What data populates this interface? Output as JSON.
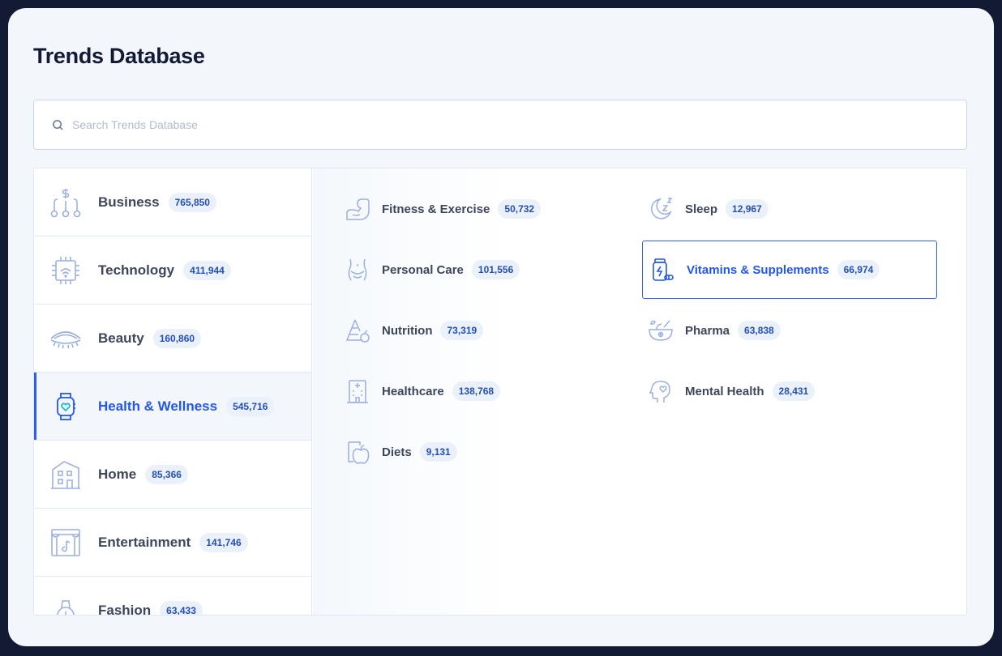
{
  "page": {
    "title": "Trends Database"
  },
  "search": {
    "placeholder": "Search Trends Database",
    "icon": "search-icon"
  },
  "colors": {
    "accent": "#2f5fe6",
    "badge_bg": "#ebf1fb",
    "badge_text": "#2450b4",
    "icon_stroke": "#9cb0e0"
  },
  "categories": [
    {
      "label": "Business",
      "count": "765,850",
      "icon": "business-icon"
    },
    {
      "label": "Technology",
      "count": "411,944",
      "icon": "chip-icon"
    },
    {
      "label": "Beauty",
      "count": "160,860",
      "icon": "eyelash-icon"
    },
    {
      "label": "Health & Wellness",
      "count": "545,716",
      "icon": "smartwatch-heart-icon",
      "active": true
    },
    {
      "label": "Home",
      "count": "85,366",
      "icon": "building-icon"
    },
    {
      "label": "Entertainment",
      "count": "141,746",
      "icon": "theater-icon"
    },
    {
      "label": "Fashion",
      "count": "63,433",
      "icon": "watch-icon"
    }
  ],
  "subcategories": [
    {
      "label": "Fitness & Exercise",
      "count": "50,732",
      "icon": "flexed-arm-icon"
    },
    {
      "label": "Sleep",
      "count": "12,967",
      "icon": "moon-zzz-icon"
    },
    {
      "label": "Personal Care",
      "count": "101,556",
      "icon": "body-icon"
    },
    {
      "label": "Vitamins & Supplements",
      "count": "66,974",
      "icon": "supplement-bottle-icon",
      "selected": true
    },
    {
      "label": "Nutrition",
      "count": "73,319",
      "icon": "food-pyramid-icon"
    },
    {
      "label": "Pharma",
      "count": "63,838",
      "icon": "mortar-pestle-icon"
    },
    {
      "label": "Healthcare",
      "count": "138,768",
      "icon": "hospital-icon"
    },
    {
      "label": "Mental Health",
      "count": "28,431",
      "icon": "head-heart-icon"
    },
    {
      "label": "Diets",
      "count": "9,131",
      "icon": "apple-icon"
    }
  ]
}
